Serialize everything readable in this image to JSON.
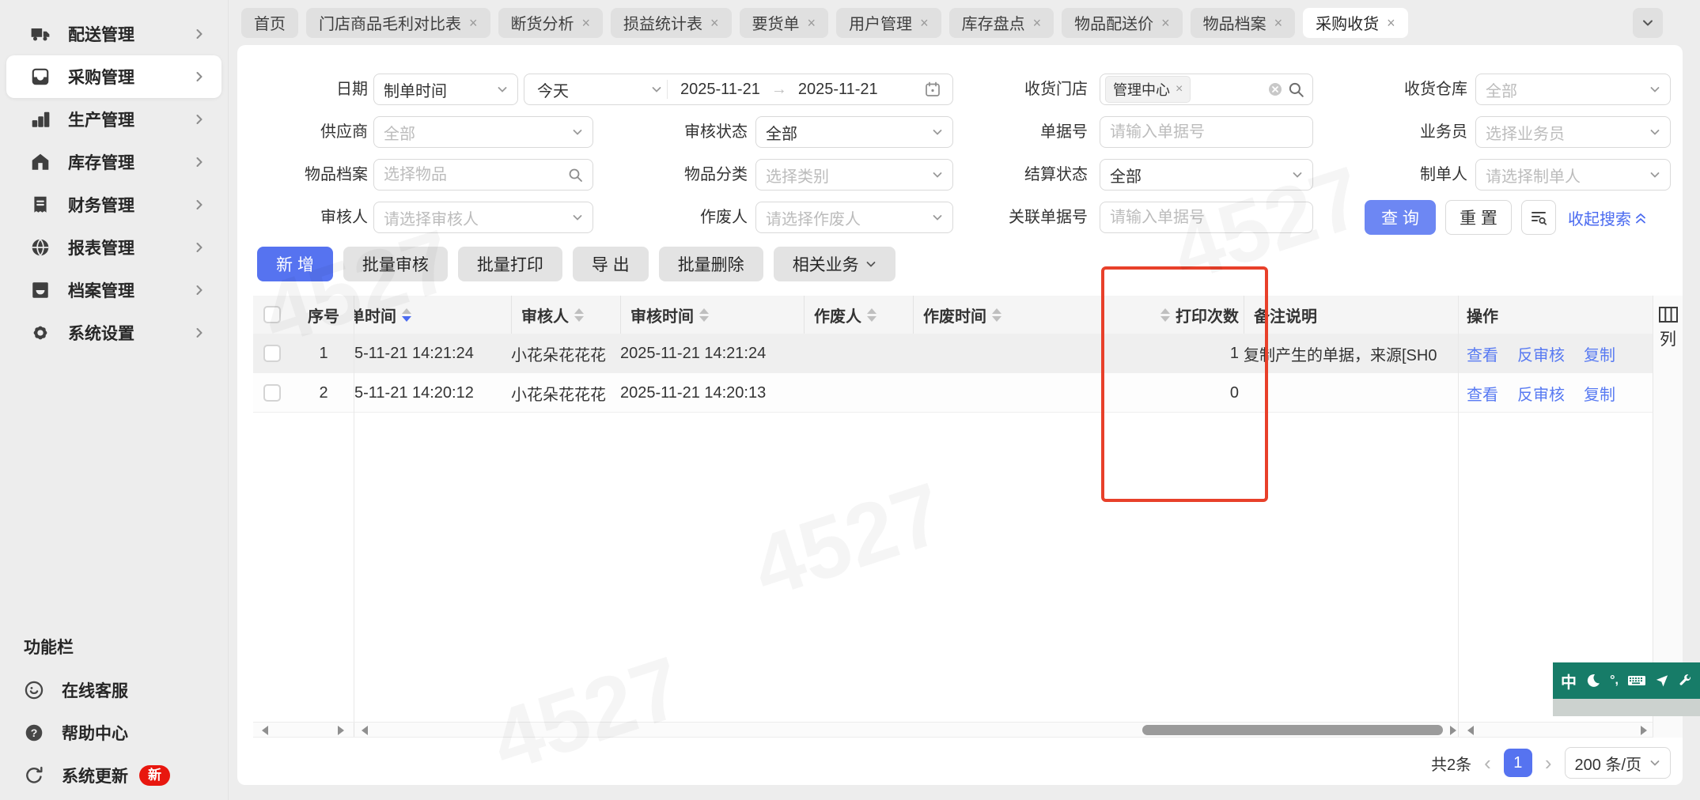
{
  "watermark": "4527",
  "sidebar": {
    "items": [
      {
        "label": "配送管理",
        "icon": "truck-icon",
        "active": false
      },
      {
        "label": "采购管理",
        "icon": "inbox-icon",
        "active": true
      },
      {
        "label": "生产管理",
        "icon": "blocks-icon",
        "active": false
      },
      {
        "label": "库存管理",
        "icon": "warehouse-icon",
        "active": false
      },
      {
        "label": "财务管理",
        "icon": "receipt-icon",
        "active": false
      },
      {
        "label": "报表管理",
        "icon": "globe-icon",
        "active": false
      },
      {
        "label": "档案管理",
        "icon": "archive-icon",
        "active": false
      },
      {
        "label": "系统设置",
        "icon": "gear-icon",
        "active": false
      }
    ],
    "footer_heading": "功能栏",
    "footer_items": [
      {
        "label": "在线客服",
        "icon": "headset-icon",
        "badge": ""
      },
      {
        "label": "帮助中心",
        "icon": "question-icon",
        "badge": ""
      },
      {
        "label": "系统更新",
        "icon": "refresh-icon",
        "badge": "新"
      }
    ]
  },
  "tabs": [
    {
      "label": "首页",
      "closable": false,
      "active": false
    },
    {
      "label": "门店商品毛利对比表",
      "closable": true,
      "active": false
    },
    {
      "label": "断货分析",
      "closable": true,
      "active": false
    },
    {
      "label": "损益统计表",
      "closable": true,
      "active": false
    },
    {
      "label": "要货单",
      "closable": true,
      "active": false
    },
    {
      "label": "用户管理",
      "closable": true,
      "active": false
    },
    {
      "label": "库存盘点",
      "closable": true,
      "active": false
    },
    {
      "label": "物品配送价",
      "closable": true,
      "active": false
    },
    {
      "label": "物品档案",
      "closable": true,
      "active": false
    },
    {
      "label": "采购收货",
      "closable": true,
      "active": true
    }
  ],
  "filters": {
    "date": {
      "label": "日期",
      "type_value": "制单时间",
      "quick_value": "今天",
      "from": "2025-11-21",
      "to": "2025-11-21"
    },
    "store": {
      "label": "收货门店",
      "tag": "管理中心"
    },
    "warehouse": {
      "label": "收货仓库",
      "placeholder": "全部"
    },
    "supplier": {
      "label": "供应商",
      "placeholder": "全部"
    },
    "audit_status": {
      "label": "审核状态",
      "value": "全部"
    },
    "bill_no": {
      "label": "单据号",
      "placeholder": "请输入单据号"
    },
    "salesman": {
      "label": "业务员",
      "placeholder": "选择业务员"
    },
    "item": {
      "label": "物品档案",
      "placeholder": "选择物品"
    },
    "category": {
      "label": "物品分类",
      "placeholder": "选择类别"
    },
    "settle_status": {
      "label": "结算状态",
      "value": "全部"
    },
    "maker": {
      "label": "制单人",
      "placeholder": "请选择制单人"
    },
    "auditor": {
      "label": "审核人",
      "placeholder": "请选择审核人"
    },
    "voider": {
      "label": "作废人",
      "placeholder": "请选择作废人"
    },
    "ref_no": {
      "label": "关联单据号",
      "placeholder": "请输入单据号"
    },
    "search_button": "查 询",
    "reset_button": "重 置",
    "collapse_link": "收起搜索"
  },
  "toolbar": [
    {
      "label": "新 增",
      "primary": true,
      "dropdown": false
    },
    {
      "label": "批量审核",
      "primary": false,
      "dropdown": false
    },
    {
      "label": "批量打印",
      "primary": false,
      "dropdown": false
    },
    {
      "label": "导 出",
      "primary": false,
      "dropdown": false
    },
    {
      "label": "批量删除",
      "primary": false,
      "dropdown": false
    },
    {
      "label": "相关业务",
      "primary": false,
      "dropdown": true
    }
  ],
  "table": {
    "columns": [
      {
        "key": "index",
        "label": "序号"
      },
      {
        "key": "time",
        "label": "制单时间",
        "sort": "desc",
        "clipped": true
      },
      {
        "key": "auditor",
        "label": "审核人",
        "sort": "none"
      },
      {
        "key": "audit_time",
        "label": "审核时间",
        "sort": "none"
      },
      {
        "key": "voider",
        "label": "作废人",
        "sort": "none"
      },
      {
        "key": "void_time",
        "label": "作废时间",
        "sort": "none"
      },
      {
        "key": "print_count",
        "label": "打印次数",
        "sort": "none",
        "sort_side": "left"
      },
      {
        "key": "remark",
        "label": "备注说明"
      },
      {
        "key": "ops",
        "label": "操作"
      }
    ],
    "rows": [
      {
        "index": "1",
        "time": "5-11-21 14:21:24",
        "auditor": "小花朵花花花",
        "audit_time": "2025-11-21 14:21:24",
        "voider": "",
        "void_time": "",
        "print_count": "1",
        "remark": "复制产生的单据，来源[SH0",
        "ops": [
          "查看",
          "反审核",
          "复制"
        ],
        "highlight": true
      },
      {
        "index": "2",
        "time": "5-11-21 14:20:12",
        "auditor": "小花朵花花花",
        "audit_time": "2025-11-21 14:20:13",
        "voider": "",
        "void_time": "",
        "print_count": "0",
        "remark": "",
        "ops": [
          "查看",
          "反审核",
          "复制"
        ],
        "highlight": false
      }
    ],
    "column_tool_label": "列"
  },
  "pagination": {
    "total": "共2条",
    "prev": "‹",
    "page": "1",
    "next": "›",
    "page_size": "200 条/页"
  },
  "ime": {
    "mode": "中",
    "punct": "°,"
  },
  "colors": {
    "accent_blue": "#5673f0",
    "annotation_red": "#e8402a",
    "ime_teal": "#177c68",
    "badge_red": "#e8170f"
  }
}
